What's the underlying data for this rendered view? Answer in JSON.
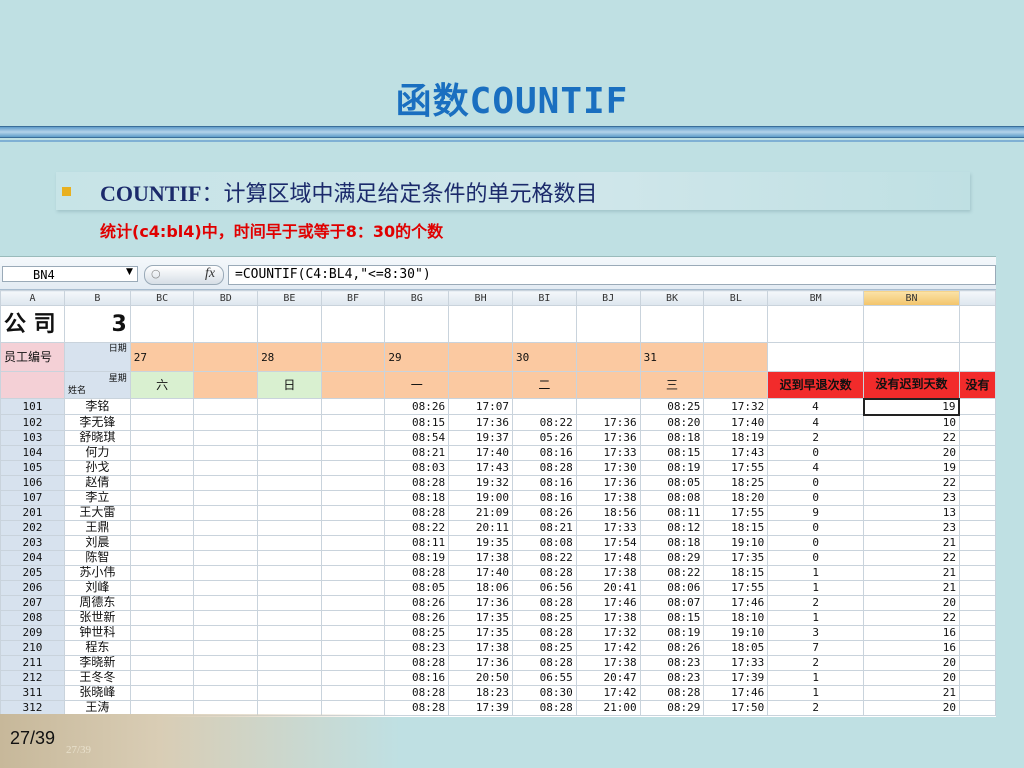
{
  "slide": {
    "title_cn": "函数",
    "title_en": "COUNTIF",
    "bullet_term": "COUNTIF",
    "bullet_rest": "：计算区域中满足给定条件的单元格数目",
    "note": "统计(c4:bl4)中，时间早于或等于8：30的个数",
    "page": "27/39",
    "page_shadow": "27/39"
  },
  "excel": {
    "name_box": "BN4",
    "fx": "fx",
    "formula": "=COUNTIF(C4:BL4,\"<=8:30\")",
    "columns": [
      "A",
      "B",
      "BC",
      "BD",
      "BE",
      "BF",
      "BG",
      "BH",
      "BI",
      "BJ",
      "BK",
      "BL",
      "BM",
      "BN",
      ""
    ],
    "company_label": "公 司",
    "company_value": "3",
    "emp_label": "员工编号",
    "date_label": "日期",
    "weekday_label": "星期",
    "name_label": "姓名",
    "dates": [
      "27",
      "28",
      "29",
      "30",
      "31"
    ],
    "weekdays": [
      "六",
      "日",
      "一",
      "二",
      "三"
    ],
    "h1": "迟到早退次数",
    "h2": "没有迟到天数",
    "h3": "没有",
    "rows": [
      [
        "101",
        "李铭",
        "",
        "",
        "",
        "",
        "08:26",
        "17:07",
        "",
        "",
        "08:25",
        "17:32",
        "4",
        "19"
      ],
      [
        "102",
        "李无锋",
        "",
        "",
        "",
        "",
        "08:15",
        "17:36",
        "08:22",
        "17:36",
        "08:20",
        "17:40",
        "4",
        "10"
      ],
      [
        "103",
        "舒晓琪",
        "",
        "",
        "",
        "",
        "08:54",
        "19:37",
        "05:26",
        "17:36",
        "08:18",
        "18:19",
        "2",
        "22"
      ],
      [
        "104",
        "何力",
        "",
        "",
        "",
        "",
        "08:21",
        "17:40",
        "08:16",
        "17:33",
        "08:15",
        "17:43",
        "0",
        "20"
      ],
      [
        "105",
        "孙戈",
        "",
        "",
        "",
        "",
        "08:03",
        "17:43",
        "08:28",
        "17:30",
        "08:19",
        "17:55",
        "4",
        "19"
      ],
      [
        "106",
        "赵倩",
        "",
        "",
        "",
        "",
        "08:28",
        "19:32",
        "08:16",
        "17:36",
        "08:05",
        "18:25",
        "0",
        "22"
      ],
      [
        "107",
        "李立",
        "",
        "",
        "",
        "",
        "08:18",
        "19:00",
        "08:16",
        "17:38",
        "08:08",
        "18:20",
        "0",
        "23"
      ],
      [
        "201",
        "王大雷",
        "",
        "",
        "",
        "",
        "08:28",
        "21:09",
        "08:26",
        "18:56",
        "08:11",
        "17:55",
        "9",
        "13"
      ],
      [
        "202",
        "王鼎",
        "",
        "",
        "",
        "",
        "08:22",
        "20:11",
        "08:21",
        "17:33",
        "08:12",
        "18:15",
        "0",
        "23"
      ],
      [
        "203",
        "刘晨",
        "",
        "",
        "",
        "",
        "08:11",
        "19:35",
        "08:08",
        "17:54",
        "08:18",
        "19:10",
        "0",
        "21"
      ],
      [
        "204",
        "陈智",
        "",
        "",
        "",
        "",
        "08:19",
        "17:38",
        "08:22",
        "17:48",
        "08:29",
        "17:35",
        "0",
        "22"
      ],
      [
        "205",
        "苏小伟",
        "",
        "",
        "",
        "",
        "08:28",
        "17:40",
        "08:28",
        "17:38",
        "08:22",
        "18:15",
        "1",
        "21"
      ],
      [
        "206",
        "刘峰",
        "",
        "",
        "",
        "",
        "08:05",
        "18:06",
        "06:56",
        "20:41",
        "08:06",
        "17:55",
        "1",
        "21"
      ],
      [
        "207",
        "周德东",
        "",
        "",
        "",
        "",
        "08:26",
        "17:36",
        "08:28",
        "17:46",
        "08:07",
        "17:46",
        "2",
        "20"
      ],
      [
        "208",
        "张世新",
        "",
        "",
        "",
        "",
        "08:26",
        "17:35",
        "08:25",
        "17:38",
        "08:15",
        "18:10",
        "1",
        "22"
      ],
      [
        "209",
        "钟世科",
        "",
        "",
        "",
        "",
        "08:25",
        "17:35",
        "08:28",
        "17:32",
        "08:19",
        "19:10",
        "3",
        "16"
      ],
      [
        "210",
        "程东",
        "",
        "",
        "",
        "",
        "08:23",
        "17:38",
        "08:25",
        "17:42",
        "08:26",
        "18:05",
        "7",
        "16"
      ],
      [
        "211",
        "李晓新",
        "",
        "",
        "",
        "",
        "08:28",
        "17:36",
        "08:28",
        "17:38",
        "08:23",
        "17:33",
        "2",
        "20"
      ],
      [
        "212",
        "王冬冬",
        "",
        "",
        "",
        "",
        "08:16",
        "20:50",
        "06:55",
        "20:47",
        "08:23",
        "17:39",
        "1",
        "20"
      ],
      [
        "311",
        "张晓峰",
        "",
        "",
        "",
        "",
        "08:28",
        "18:23",
        "08:30",
        "17:42",
        "08:28",
        "17:46",
        "1",
        "21"
      ],
      [
        "312",
        "王涛",
        "",
        "",
        "",
        "",
        "08:28",
        "17:39",
        "08:28",
        "21:00",
        "08:29",
        "17:50",
        "2",
        "20"
      ]
    ]
  },
  "colors": {
    "title": "#1a6fc0",
    "note": "#e00000",
    "header_peach": "#fbc9a1",
    "header_red": "#f22b2b",
    "selected_col": "#f2c46a"
  }
}
